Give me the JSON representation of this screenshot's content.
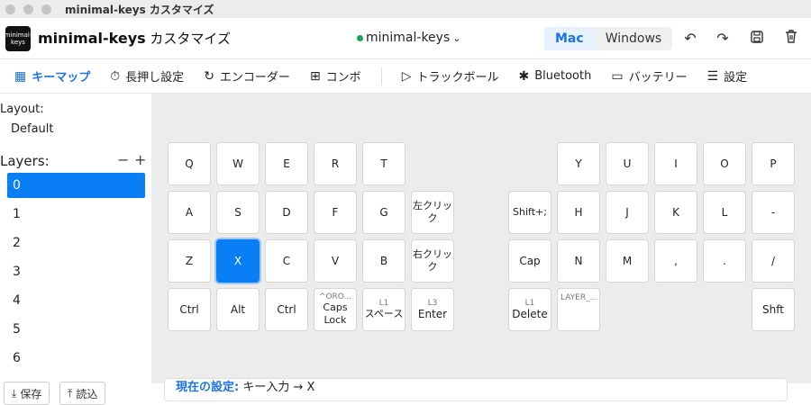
{
  "window": {
    "title": "minimal-keys カスタマイズ"
  },
  "header": {
    "logo_text": "minimal-keys",
    "app_name": "minimal-keys",
    "app_name_sub": " カスタマイズ",
    "keyboard": "minimal-keys",
    "os_options": [
      "Mac",
      "Windows"
    ],
    "os_selected": "Mac"
  },
  "toolbar": [
    {
      "label": "キーマップ",
      "icon": "grid-icon"
    },
    {
      "label": "長押し設定",
      "icon": "timer-icon"
    },
    {
      "label": "エンコーダー",
      "icon": "rotate-icon"
    },
    {
      "label": "コンボ",
      "icon": "combo-icon"
    },
    {
      "label": "トラックボール",
      "icon": "cursor-icon"
    },
    {
      "label": "Bluetooth",
      "icon": "bluetooth-icon"
    },
    {
      "label": "バッテリー",
      "icon": "battery-icon"
    },
    {
      "label": "設定",
      "icon": "sliders-icon"
    }
  ],
  "sidebar": {
    "layout_label": "Layout:",
    "layout_value": "Default",
    "layers_label": "Layers:",
    "layers": [
      "0",
      "1",
      "2",
      "3",
      "4",
      "5",
      "6"
    ],
    "selected_layer": "0",
    "save_label": "保存",
    "load_label": "読込"
  },
  "keys": {
    "left": [
      [
        "Q",
        "W",
        "E",
        "R",
        "T"
      ],
      [
        "A",
        "S",
        "D",
        "F",
        "G",
        "左クリック"
      ],
      [
        "Z",
        "X",
        "C",
        "V",
        "B",
        "右クリック"
      ],
      [
        "Ctrl",
        "Alt",
        "Ctrl",
        "Caps Lock",
        "スペース",
        "Enter"
      ]
    ],
    "right": [
      [
        "Y",
        "U",
        "I",
        "O",
        "P"
      ],
      [
        "Shift+;",
        "H",
        "J",
        "K",
        "L",
        "-"
      ],
      [
        "Cap",
        "N",
        "M",
        ",",
        ".",
        "/"
      ],
      [
        "Delete",
        "LAYER_...",
        "Shft"
      ]
    ],
    "caps_top": "^ORO...",
    "space_top": "L1",
    "enter_top": "L3",
    "delete_top": "L1",
    "selected": "X"
  },
  "status": {
    "label": "現在の設定:",
    "value": "キー入力 → X"
  }
}
